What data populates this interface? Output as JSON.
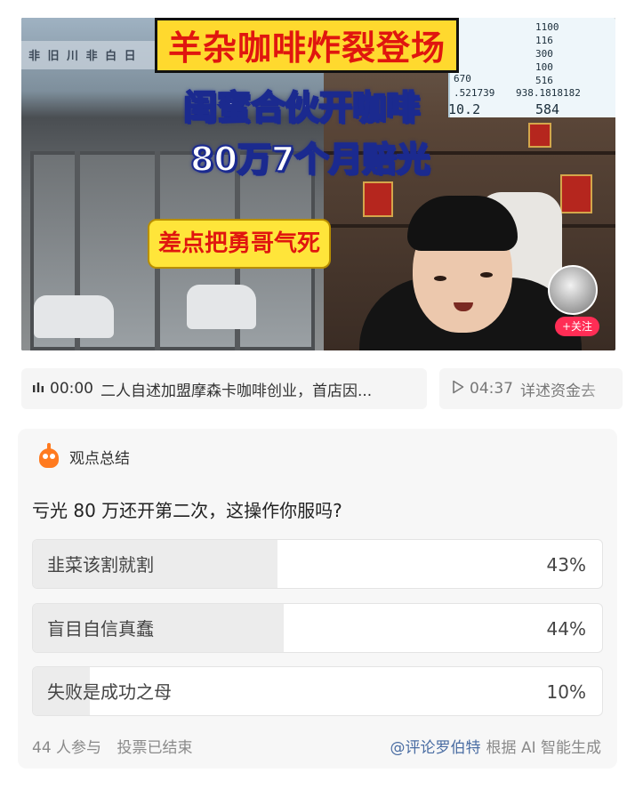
{
  "video": {
    "captions": [
      "羊杂咖啡炸裂登场",
      "闺蜜合伙开咖啡",
      "80万7个月赔光",
      "差点把勇哥气死"
    ],
    "table_values": [
      "1100",
      "116",
      "300",
      "100",
      "516",
      "938.1818182",
      "584",
      "670",
      ".521739",
      "10.2"
    ],
    "follow_label": "+关注"
  },
  "segments": [
    {
      "icon": "audio-bars-icon",
      "time": "00:00",
      "text": "二人自述加盟摩森卡咖啡创业，首店因..."
    },
    {
      "icon": "play-icon",
      "time": "04:37",
      "text": "详述资金去"
    }
  ],
  "poll": {
    "header": "观点总结",
    "question": "亏光 80 万还开第二次，这操作你服吗?",
    "options": [
      {
        "label": "韭菜该割就割",
        "percent_text": "43%",
        "percent": 43
      },
      {
        "label": "盲目自信真蠢",
        "percent_text": "44%",
        "percent": 44
      },
      {
        "label": "失败是成功之母",
        "percent_text": "10%",
        "percent": 10
      }
    ],
    "participants": "44 人参与",
    "status": "投票已结束",
    "author": "@评论罗伯特",
    "generated": "根据 AI 智能生成"
  }
}
